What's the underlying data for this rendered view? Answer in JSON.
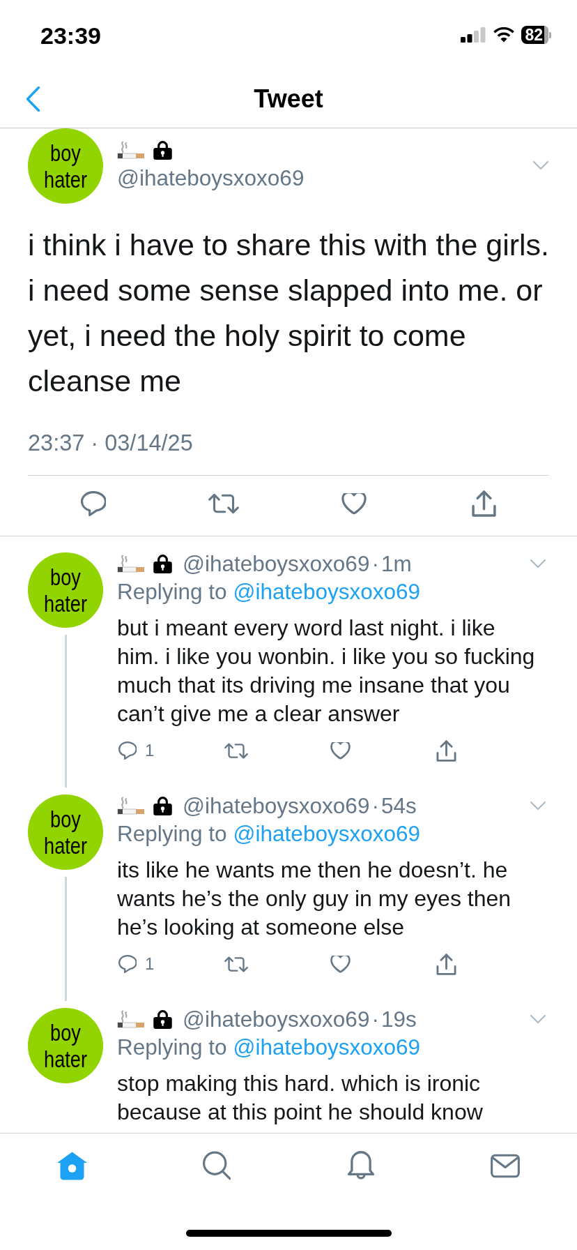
{
  "status_bar": {
    "time": "23:39",
    "battery": "82"
  },
  "nav_bar": {
    "title": "Tweet"
  },
  "tweet": {
    "avatar_text": "boy hater",
    "protected": true,
    "handle": "@ihateboysxoxo69",
    "text": "i think i have to share this with the girls. i need some sense slapped into me. or yet, i need the holy spirit to come cleanse me",
    "timestamp": "23:37 · 03/14/25",
    "actions": [
      {
        "kind": "reply"
      },
      {
        "kind": "retweet"
      },
      {
        "kind": "like"
      },
      {
        "kind": "share"
      }
    ]
  },
  "replies": [
    {
      "avatar_text": "boy hater",
      "protected": true,
      "handle": "@ihateboysxoxo69",
      "separator": "·",
      "time": "1m",
      "replying_label": "Replying to",
      "replying_to": "@ihateboysxoxo69",
      "text": "but i meant every word last night. i like him. i like you wonbin. i like you so fucking much that its driving me insane that you can’t give me a clear answer",
      "thread_continues": true,
      "actions": [
        {
          "kind": "reply",
          "count": "1"
        },
        {
          "kind": "retweet"
        },
        {
          "kind": "like"
        },
        {
          "kind": "share"
        }
      ]
    },
    {
      "avatar_text": "boy hater",
      "protected": true,
      "handle": "@ihateboysxoxo69",
      "separator": "·",
      "time": "54s",
      "replying_label": "Replying to",
      "replying_to": "@ihateboysxoxo69",
      "text": "its like he wants me then he doesn’t. he wants he’s the only guy in my eyes then he’s looking at someone else",
      "thread_continues": true,
      "actions": [
        {
          "kind": "reply",
          "count": "1"
        },
        {
          "kind": "retweet"
        },
        {
          "kind": "like"
        },
        {
          "kind": "share"
        }
      ]
    },
    {
      "avatar_text": "boy hater",
      "protected": true,
      "handle": "@ihateboysxoxo69",
      "separator": "·",
      "time": "19s",
      "replying_label": "Replying to",
      "replying_to": "@ihateboysxoxo69",
      "text": "stop making this hard. which is ironic because at this point he should know"
    }
  ],
  "tab_bar": {
    "items": [
      {
        "kind": "home",
        "selected": true
      },
      {
        "kind": "search",
        "selected": false
      },
      {
        "kind": "notifications",
        "selected": false
      },
      {
        "kind": "messages",
        "selected": false
      }
    ]
  }
}
